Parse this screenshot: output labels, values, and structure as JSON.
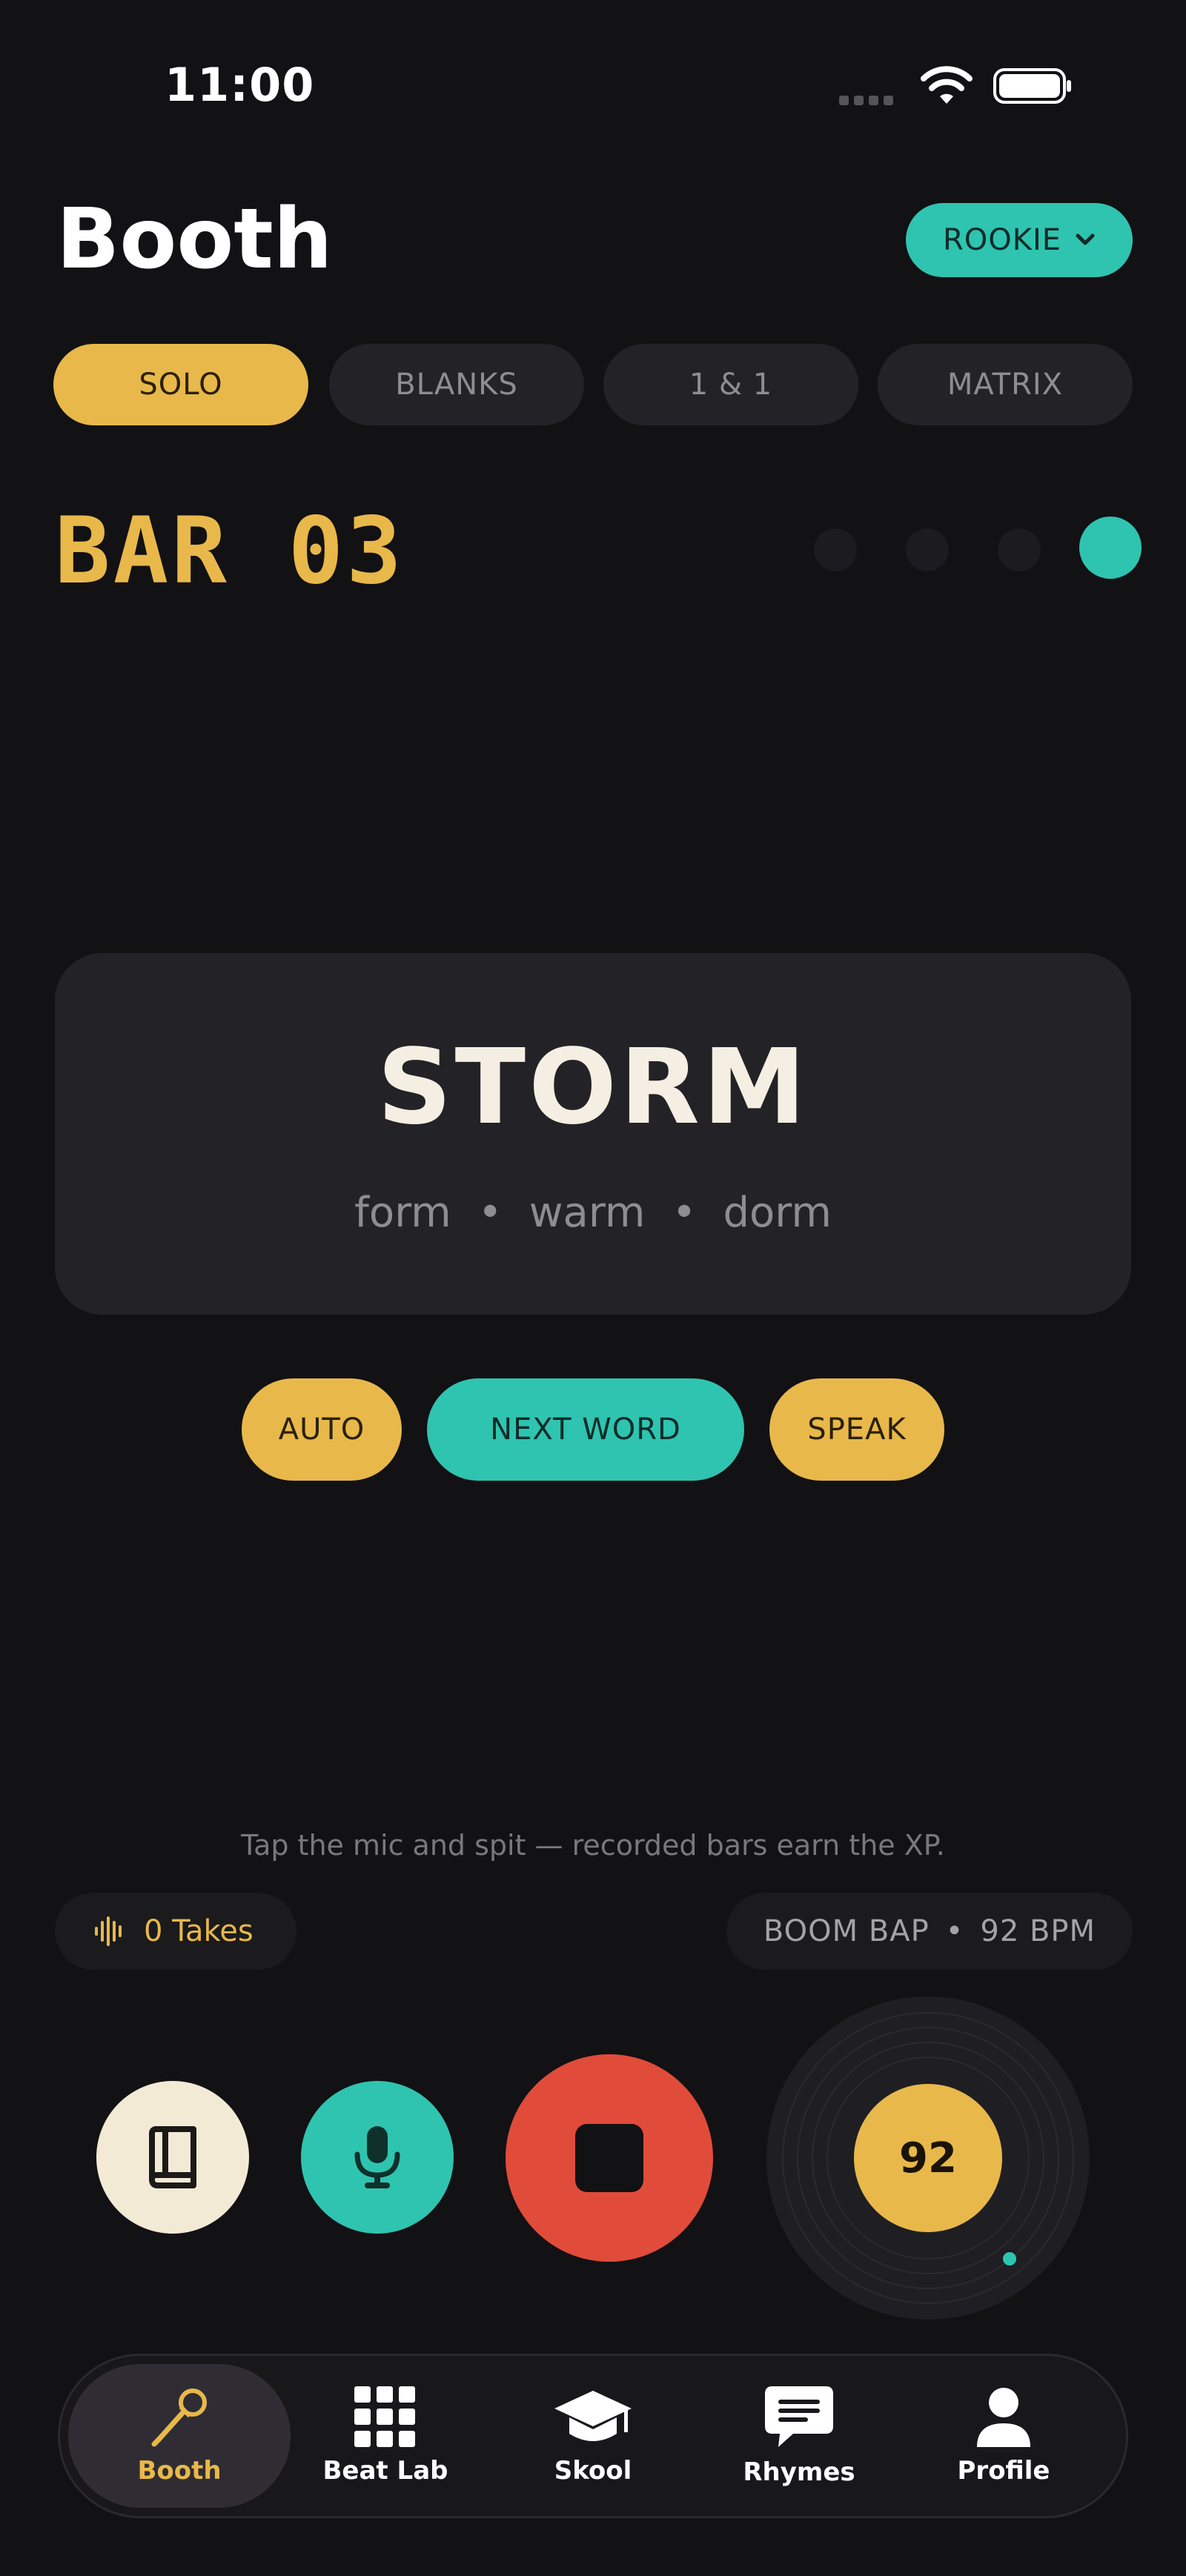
{
  "status_bar": {
    "time": "11:00"
  },
  "header": {
    "title": "Booth",
    "level": "ROOKIE"
  },
  "modes": [
    {
      "label": "SOLO",
      "active": true
    },
    {
      "label": "BLANKS",
      "active": false
    },
    {
      "label": "1 & 1",
      "active": false
    },
    {
      "label": "MATRIX",
      "active": false
    }
  ],
  "bar": {
    "label": "BAR 03",
    "current_step": 4,
    "total_steps": 4
  },
  "word_card": {
    "word": "STORM",
    "rhymes": [
      "form",
      "warm",
      "dorm"
    ]
  },
  "actions": {
    "auto": "AUTO",
    "next_word": "NEXT WORD",
    "speak": "SPEAK"
  },
  "hint": "Tap the mic and spit — recorded bars earn the XP.",
  "takes": "0 Takes",
  "beat": {
    "style": "BOOM BAP",
    "bpm_label": "92 BPM",
    "bpm": "92"
  },
  "nav": [
    {
      "label": "Booth",
      "icon": "microphone-icon",
      "active": true
    },
    {
      "label": "Beat Lab",
      "icon": "grid-icon",
      "active": false
    },
    {
      "label": "Skool",
      "icon": "graduation-cap-icon",
      "active": false
    },
    {
      "label": "Rhymes",
      "icon": "chat-bubble-icon",
      "active": false
    },
    {
      "label": "Profile",
      "icon": "person-icon",
      "active": false
    }
  ],
  "colors": {
    "background": "#121114",
    "gold": "#e8b84a",
    "teal": "#2ec4b0",
    "record": "#e14b3a",
    "card": "#232226"
  }
}
